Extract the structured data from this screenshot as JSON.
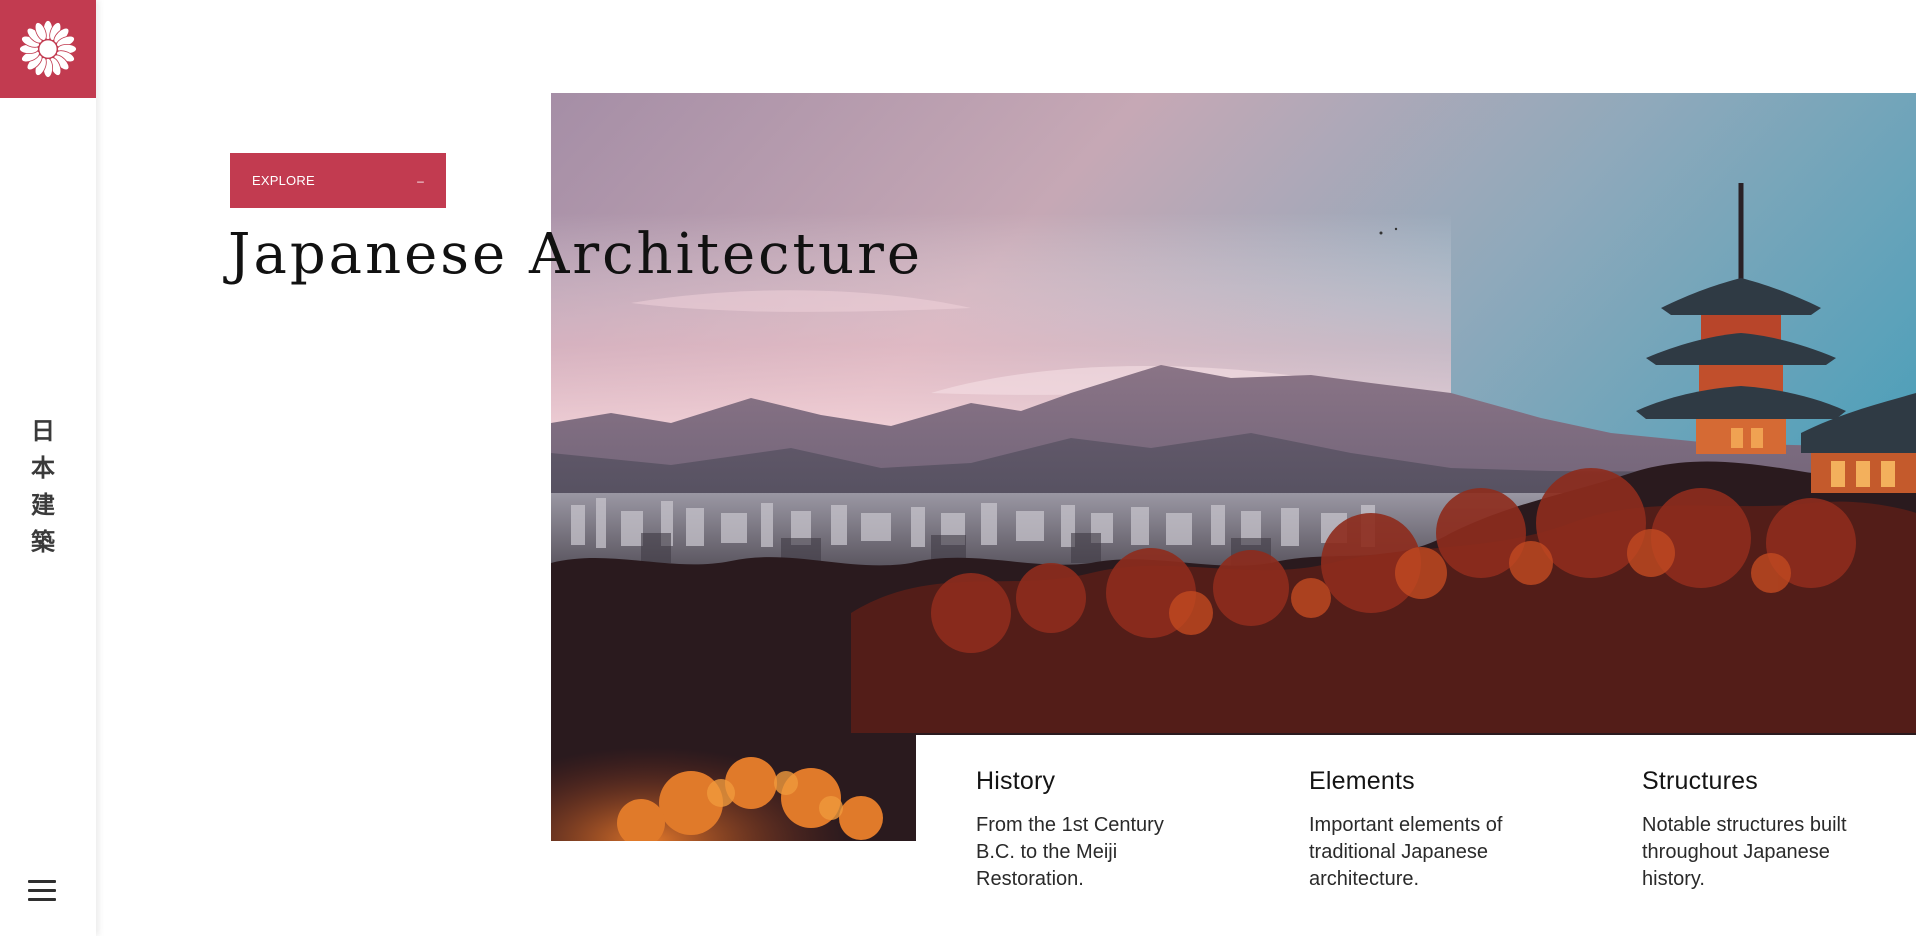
{
  "brand": {
    "logo_icon": "chrysanthemum-crest-icon",
    "accent_color": "#c23b50",
    "vertical_title": [
      "日",
      "本",
      "建",
      "築"
    ]
  },
  "menu": {
    "icon": "hamburger-menu-icon"
  },
  "hero": {
    "explore_label": "EXPLORE",
    "explore_icon": "–",
    "title": "Japanese Architecture",
    "image": "kyoto-pagoda-sunset-landscape"
  },
  "cards": [
    {
      "title": "History",
      "text": "From the 1st Century B.C. to the Meiji Restoration."
    },
    {
      "title": "Elements",
      "text": "Important elements of traditional Japanese architecture."
    },
    {
      "title": "Structures",
      "text": "Notable structures built throughout Japanese history."
    }
  ]
}
